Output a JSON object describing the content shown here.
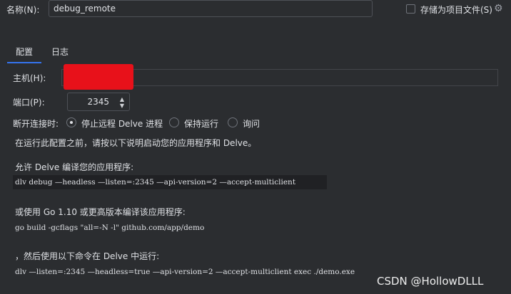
{
  "name": {
    "label": "名称(N):",
    "value": "debug_remote"
  },
  "store_as_project_file": {
    "label": "存储为项目文件(S)",
    "checked": false
  },
  "tabs": [
    {
      "label": "配置",
      "active": true
    },
    {
      "label": "日志",
      "active": false
    }
  ],
  "host": {
    "label": "主机(H):",
    "value": ""
  },
  "port": {
    "label": "端口(P):",
    "value": "2345"
  },
  "on_disconnect": {
    "label": "断开连接时:",
    "options": [
      {
        "label": "停止远程 Delve 进程",
        "selected": true
      },
      {
        "label": "保持运行",
        "selected": false
      },
      {
        "label": "询问",
        "selected": false
      }
    ]
  },
  "instructions": {
    "intro": "在运行此配置之前，请按以下说明启动您的应用程序和 Delve。",
    "step1_text": "允许 Delve 编译您的应用程序:",
    "step1_cmd": "dlv debug —headless —listen=:2345 —api-version=2 —accept-multiclient",
    "step2_text": "或使用 Go 1.10 或更高版本编译该应用程序:",
    "step2_cmd": "go build -gcflags \"all=-N -l\" github.com/app/demo",
    "step3_text": "，然后使用以下命令在 Delve 中运行:",
    "step3_cmd": "dlv —listen=:2345 —headless=true —api-version=2 —accept-multiclient exec ./demo.exe"
  },
  "watermark": "CSDN @HollowDLLL",
  "colors": {
    "background": "#2b2d30",
    "accent": "#3574f0",
    "redaction": "#e8111a"
  }
}
